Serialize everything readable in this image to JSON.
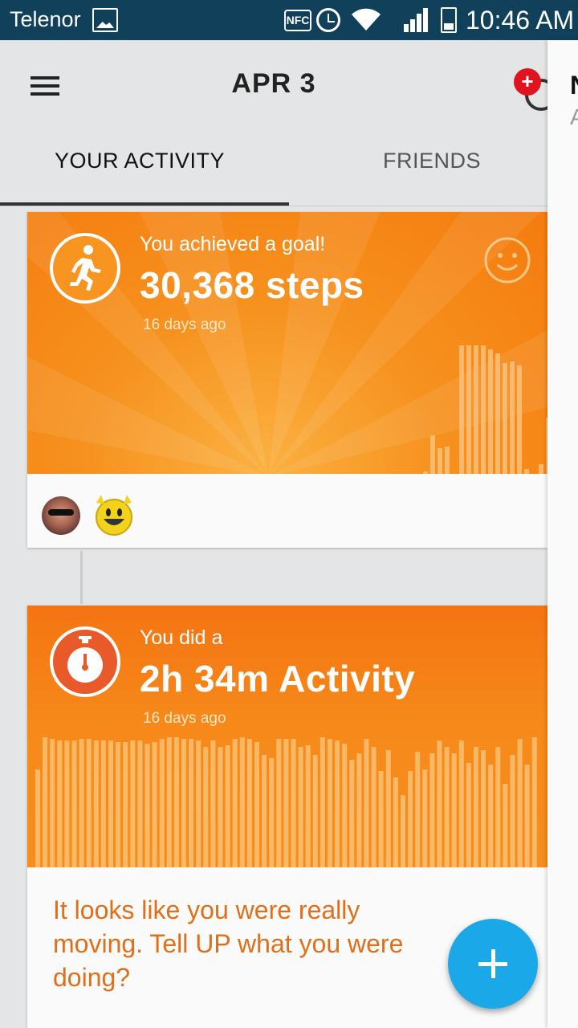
{
  "status_bar": {
    "carrier": "Telenor",
    "nfc_label": "NFC",
    "time": "10:46 AM",
    "icons": [
      "gallery-icon",
      "nfc-icon",
      "alarm-icon",
      "wifi-icon",
      "signal-icon",
      "battery-icon"
    ]
  },
  "app_bar": {
    "title": "APR 3",
    "menu_icon": "menu-icon",
    "notification_icon": "notification-icon",
    "notification_glyph": "+"
  },
  "tabs": [
    {
      "label": "YOUR ACTIVITY",
      "selected": true
    },
    {
      "label": "FRIENDS",
      "selected": false
    }
  ],
  "drawer_peek": {
    "line1": "N",
    "line2": "A"
  },
  "cards": [
    {
      "type": "goal",
      "subtitle": "You achieved a goal!",
      "headline": "30,368 steps",
      "age": "16 days ago",
      "icon": "running-person-icon",
      "reaction_icon": "smiley-icon",
      "reactions": [
        "user-avatar",
        "emoji-cheer"
      ],
      "colors": {
        "banner": "#f6911e",
        "bars": "#fbc07a"
      }
    },
    {
      "type": "activity",
      "subtitle": "You did a",
      "headline": "2h 34m Activity",
      "age": "16 days ago",
      "icon": "stopwatch-icon",
      "message_lines": [
        "It looks like you were really",
        "moving. Tell UP what you were",
        "doing?"
      ],
      "colors": {
        "banner": "#f6891a",
        "bars": "#fbbf72",
        "message": "#e06f1a"
      }
    }
  ],
  "fab": {
    "icon": "plus-icon",
    "color": "#1ba8e8"
  }
}
